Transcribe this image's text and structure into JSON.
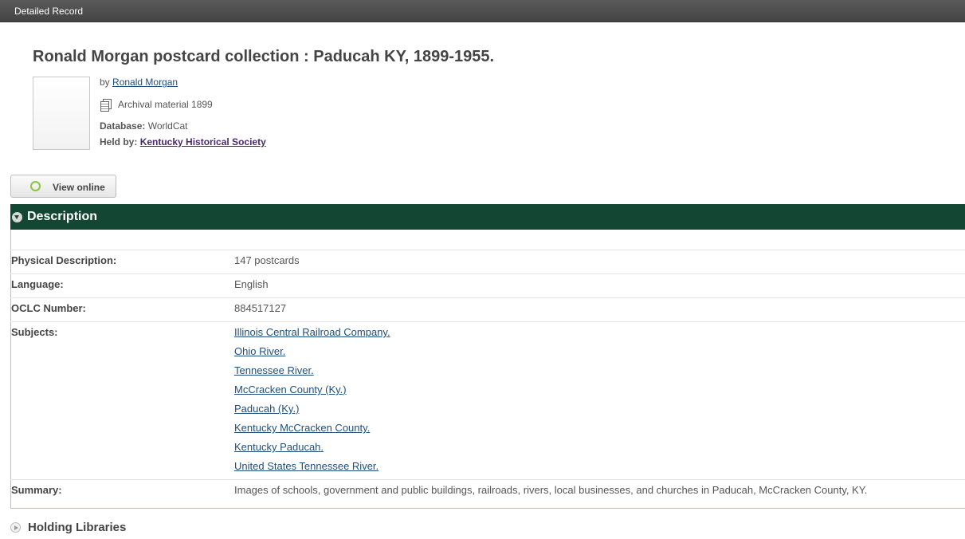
{
  "header": {
    "title": "Detailed Record"
  },
  "record": {
    "title": "Ronald Morgan postcard collection : Paducah KY, 1899-1955.",
    "by_prefix": "by",
    "author": "Ronald Morgan",
    "format": "Archival material 1899",
    "database_label": "Database:",
    "database_value": "WorldCat",
    "held_label": "Held by:",
    "held_value": "Kentucky Historical Society"
  },
  "view_button": {
    "label": "View online"
  },
  "description": {
    "heading": "Description",
    "rows": [
      {
        "label": "Physical Description:",
        "value": "147 postcards"
      },
      {
        "label": "Language:",
        "value": "English"
      },
      {
        "label": "OCLC Number:",
        "value": "884517127"
      }
    ],
    "subjects_label": "Subjects:",
    "subjects": [
      "Illinois Central Railroad Company.",
      "Ohio River.",
      "Tennessee River.",
      "McCracken County (Ky.)",
      "Paducah (Ky.)",
      "Kentucky McCracken County.",
      "Kentucky Paducah.",
      "United States Tennessee River."
    ],
    "summary_label": "Summary:",
    "summary": "Images of schools, government and public buildings, railroads, rivers, local businesses, and churches in Paducah, McCracken County, KY."
  },
  "holding": {
    "heading": "Holding Libraries"
  },
  "colors": {
    "section_header": "#134734",
    "link": "#1f4e79",
    "held_link": "#4a2a66",
    "view_ring": "#8cc63f"
  },
  "icons": [
    "archival-material-icon",
    "view-online-icon",
    "collapse-arrow-icon",
    "expand-arrow-icon"
  ]
}
